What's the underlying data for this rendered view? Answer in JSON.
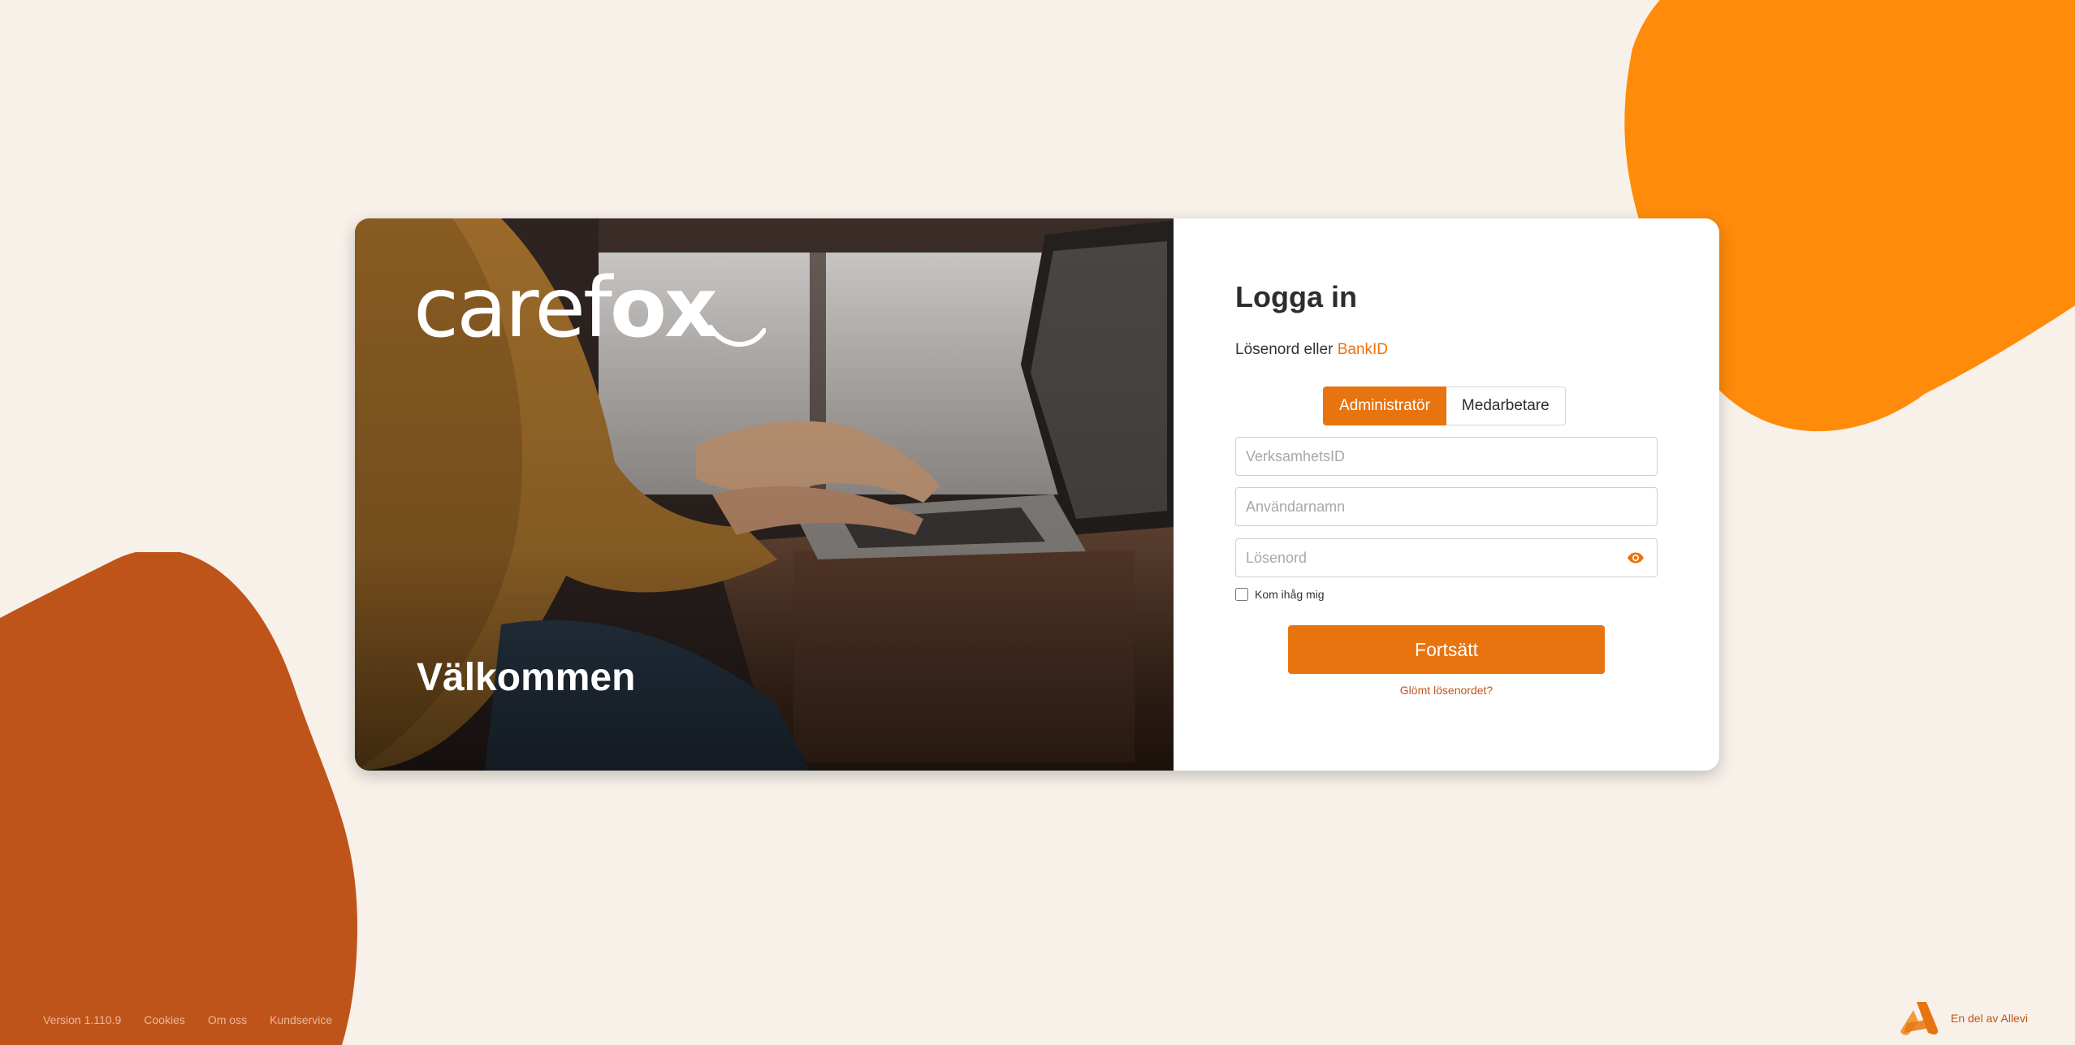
{
  "colors": {
    "background": "#f8f1ea",
    "accent": "#e8740f",
    "blob_orange": "#ff8b0a",
    "blob_rust": "#bf541b",
    "link_dark": "#c0561c"
  },
  "hero": {
    "logo_part1": "caref",
    "logo_part2": "ox",
    "welcome": "Välkommen"
  },
  "login": {
    "title": "Logga in",
    "methods_prefix": "Lösenord eller ",
    "methods_link": "BankID",
    "roles": [
      {
        "label": "Administratör",
        "active": true
      },
      {
        "label": "Medarbetare",
        "active": false
      }
    ],
    "fields": {
      "org_id_placeholder": "VerksamhetsID",
      "username_placeholder": "Användarnamn",
      "password_placeholder": "Lösenord"
    },
    "remember_label": "Kom ihåg mig",
    "submit_label": "Fortsätt",
    "forgot_label": "Glömt lösenordet?"
  },
  "footer": {
    "version": "Version 1.110.9",
    "links": [
      "Cookies",
      "Om oss",
      "Kundservice"
    ],
    "partner": "En del av Allevi"
  },
  "icons": {
    "password_toggle": "eye-icon",
    "partner_logo": "allevi-logo"
  }
}
